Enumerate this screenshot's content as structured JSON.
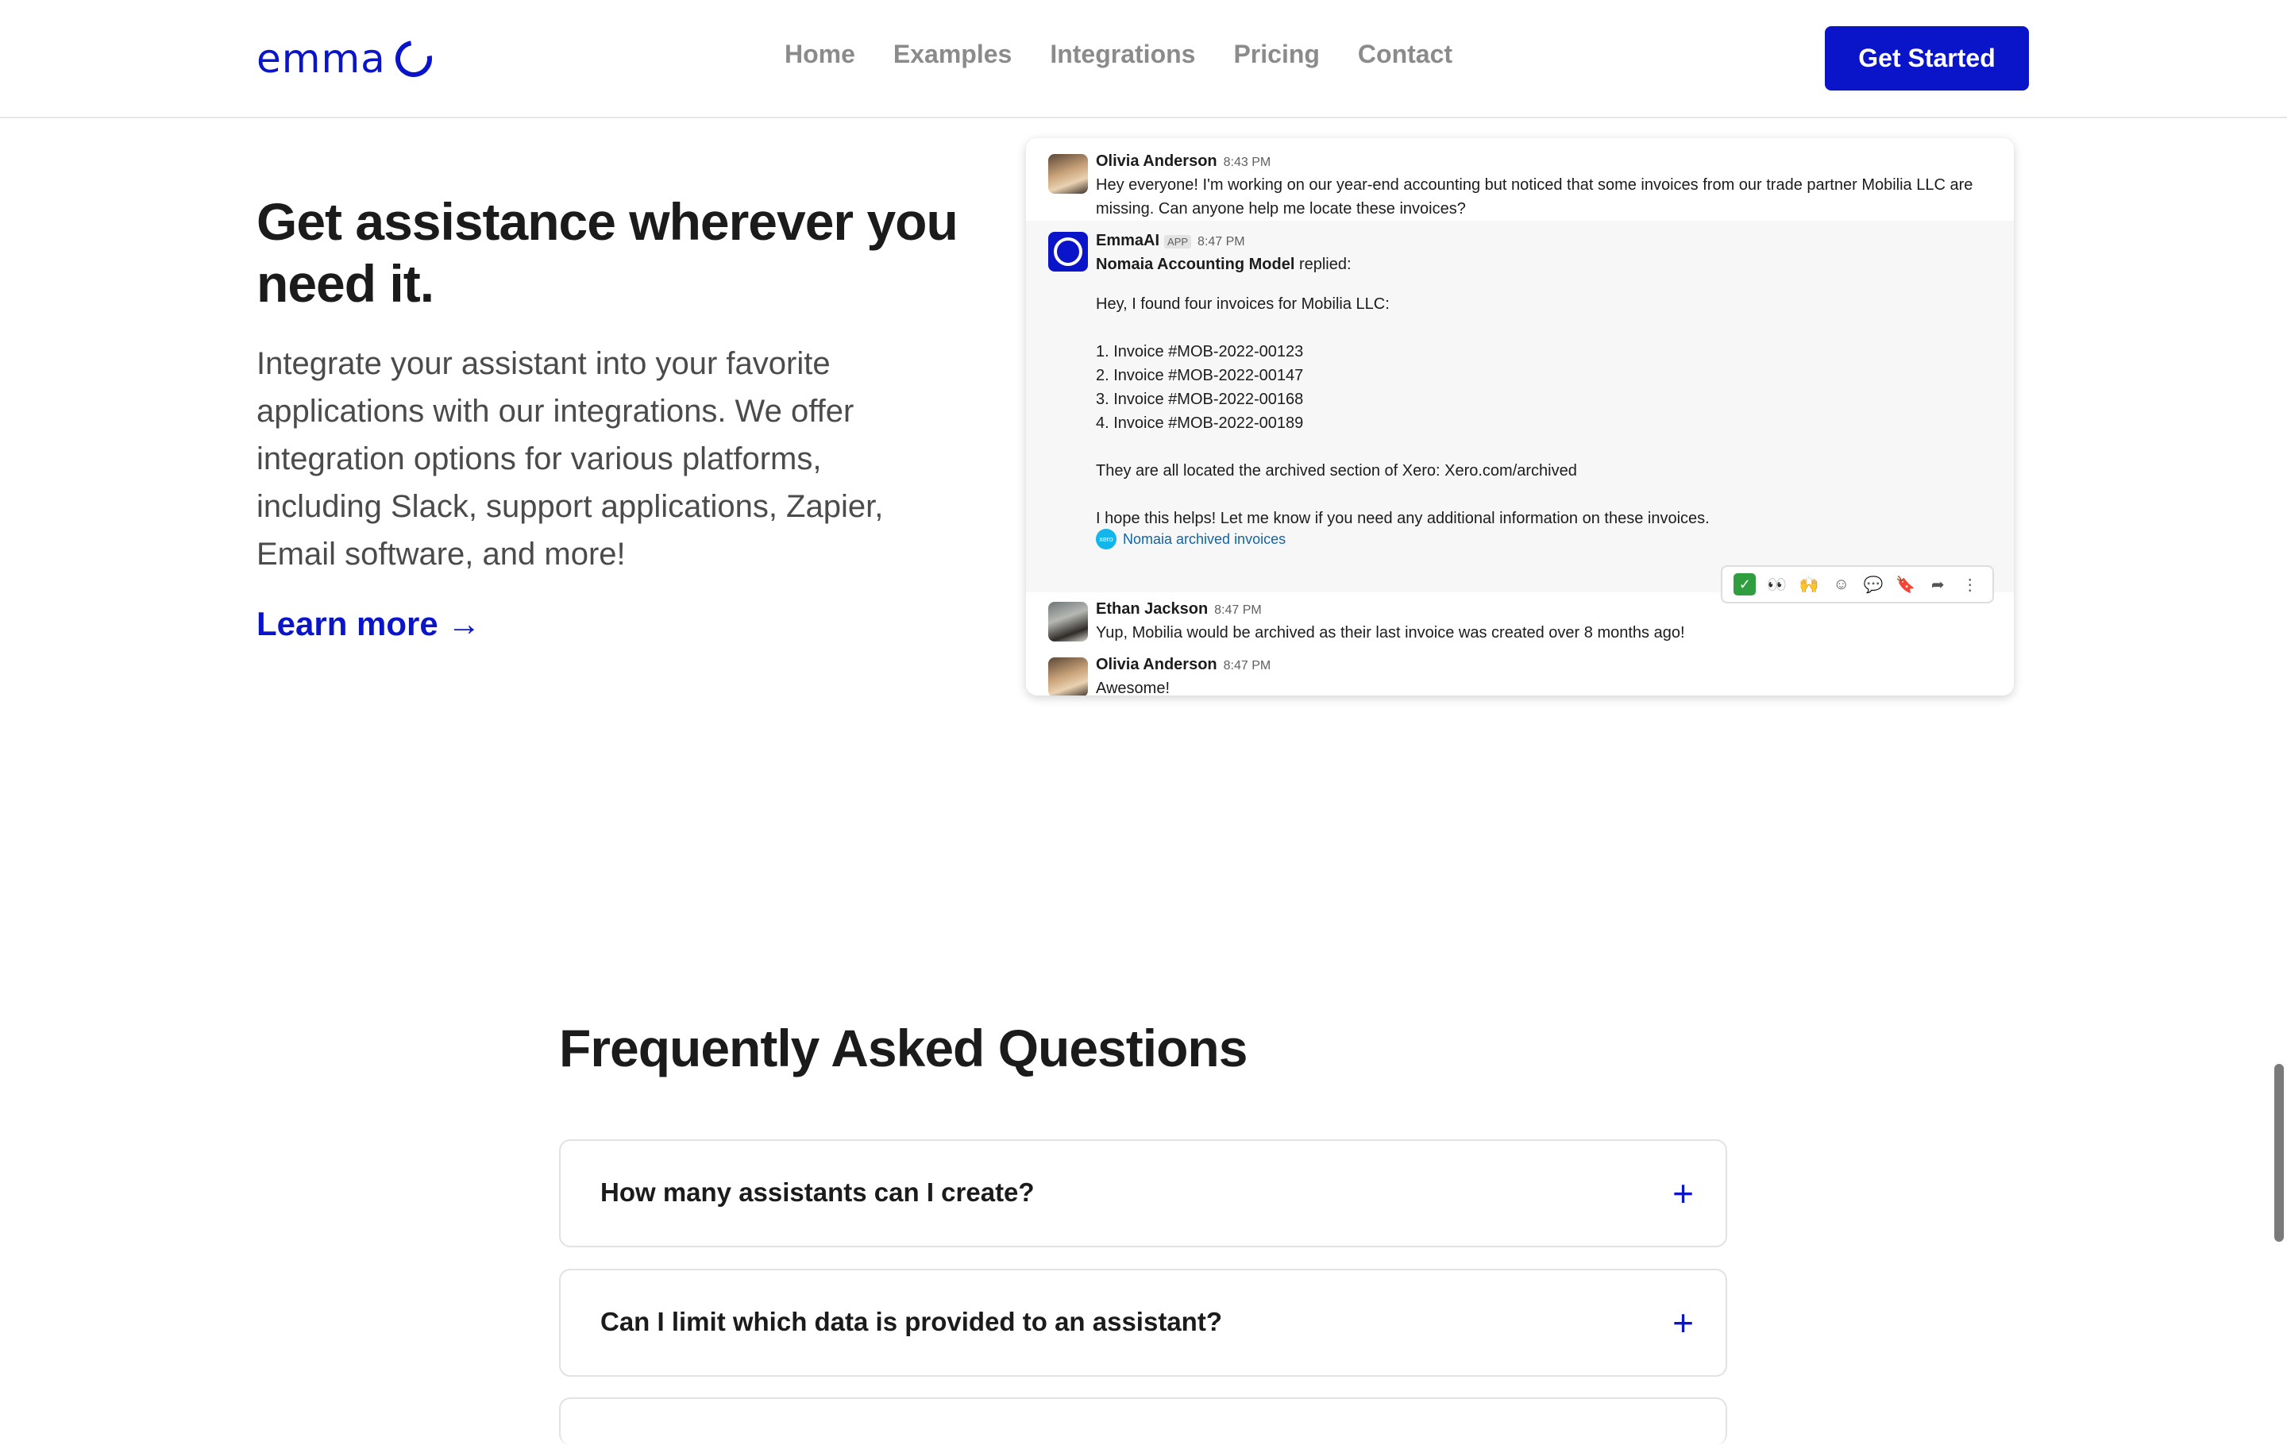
{
  "header": {
    "logo_text": "emma",
    "nav": [
      "Home",
      "Examples",
      "Integrations",
      "Pricing",
      "Contact"
    ],
    "cta_label": "Get Started",
    "brand_color": "#0a14c8"
  },
  "hero": {
    "title": "Get assistance wherever you need it.",
    "description": "Integrate your assistant into your favorite applications with our integrations. We offer integration options for various platforms, including Slack, support applications, Zapier, Email software, and more!",
    "learn_more": "Learn more →"
  },
  "chat": {
    "messages": [
      {
        "name": "Olivia Anderson",
        "time": "8:43 PM",
        "text": "Hey everyone! I'm working on our year-end accounting but noticed that some invoices from our trade partner Mobilia LLC are missing. Can anyone help me locate these invoices?"
      },
      {
        "name": "EmmaAI",
        "badge": "APP",
        "time": "8:47 PM",
        "model_name": "Nomaia Accounting Model",
        "replied": "replied:",
        "text": "Hey, I found four invoices for Mobilia LLC:\n\n1. Invoice #MOB-2022-00123\n2. Invoice #MOB-2022-00147\n3. Invoice #MOB-2022-00168\n4. Invoice #MOB-2022-00189\n\nThey are all located the archived section of Xero: Xero.com/archived\n\nI hope this helps! Let me know if you need any additional information on these invoices.",
        "attachment_icon": "xero",
        "attachment": "Nomaia archived invoices"
      },
      {
        "name": "Ethan Jackson",
        "time": "8:47 PM",
        "text": "Yup, Mobilia would be archived as their last invoice was created over 8 months ago!"
      },
      {
        "name": "Olivia Anderson",
        "time": "8:47 PM",
        "text": "Awesome!"
      }
    ],
    "toolbar_icons": [
      "check-mark-reaction-icon",
      "eyes-reaction-icon",
      "raised-hands-reaction-icon",
      "add-reaction-icon",
      "reply-thread-icon",
      "bookmark-icon",
      "share-icon",
      "more-actions-icon"
    ],
    "toolbar_glyphs": [
      "✓",
      "👀",
      "🙌",
      "☺",
      "💬",
      "🔖",
      "➦",
      "⋮"
    ]
  },
  "faq": {
    "title": "Frequently Asked Questions",
    "items": [
      {
        "question": "How many assistants can I create?",
        "icon": "+"
      },
      {
        "question": "Can I limit which data is provided to an assistant?",
        "icon": "+"
      }
    ]
  }
}
